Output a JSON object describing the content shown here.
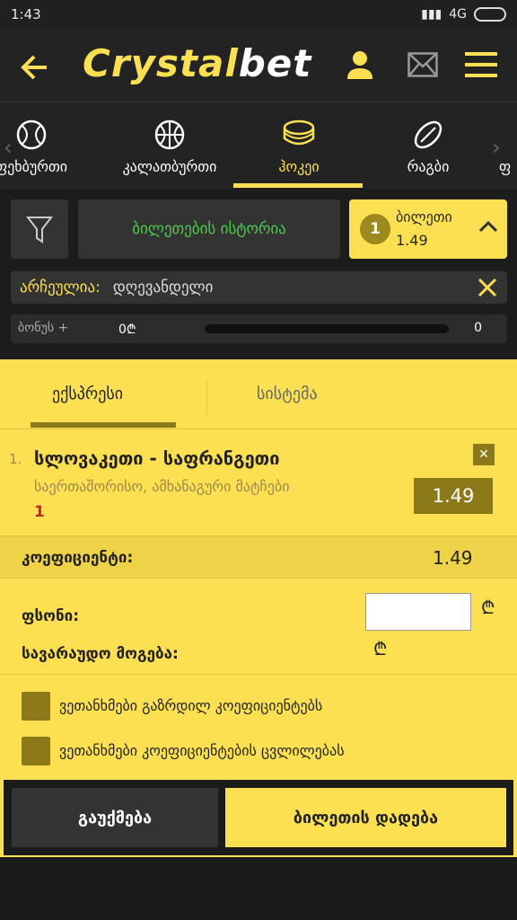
{
  "status_bar": {
    "time": "1:43",
    "network": "4G"
  },
  "header": {
    "logo_part1": "Crystal",
    "logo_part2": "bet"
  },
  "sports": [
    {
      "label": "ფეხბურთი",
      "icon": "soccer-ball-icon"
    },
    {
      "label": "კალათბურთი",
      "icon": "basketball-icon"
    },
    {
      "label": "ჰოკეი",
      "icon": "hockey-puck-icon",
      "active": true
    },
    {
      "label": "რაგბი",
      "icon": "rugby-ball-icon"
    },
    {
      "label": "ფ",
      "icon": ""
    }
  ],
  "toolbar": {
    "history_label": "ბილეთების ისტორია",
    "ticket_count": "1",
    "ticket_label": "ბილეთი",
    "ticket_coef": "1.49"
  },
  "selected": {
    "key": "არჩეულია:",
    "value": "დღევანდელი"
  },
  "bonus": {
    "label": "ბონუს +",
    "value": "0₾",
    "max": "0",
    "progress": 0
  },
  "slip": {
    "tabs": [
      "ექსპრესი",
      "სისტემა"
    ],
    "bet": {
      "number": "1.",
      "title": "სლოვაკეთი - საფრანგეთი",
      "subtitle": "საერთაშორისო, ამხანაგური მატჩები",
      "pick": "1",
      "odd": "1.49"
    },
    "coef_label": "კოეფიციენტი:",
    "coef_value": "1.49",
    "stake_label": "ფსონი:",
    "stake_value": "",
    "currency": "₾",
    "win_label": "სავარაუდო მოგება:",
    "checks": [
      "ვეთანხმები გაზრდილ კოეფიციენტებს",
      "ვეთანხმები კოეფიციენტების ცვლილებას"
    ],
    "cancel_label": "გაუქმება",
    "place_label": "ბილეთის დადება"
  },
  "colors": {
    "accent": "#fde052",
    "dark": "#8c7a1a",
    "green": "#4ec94e"
  }
}
